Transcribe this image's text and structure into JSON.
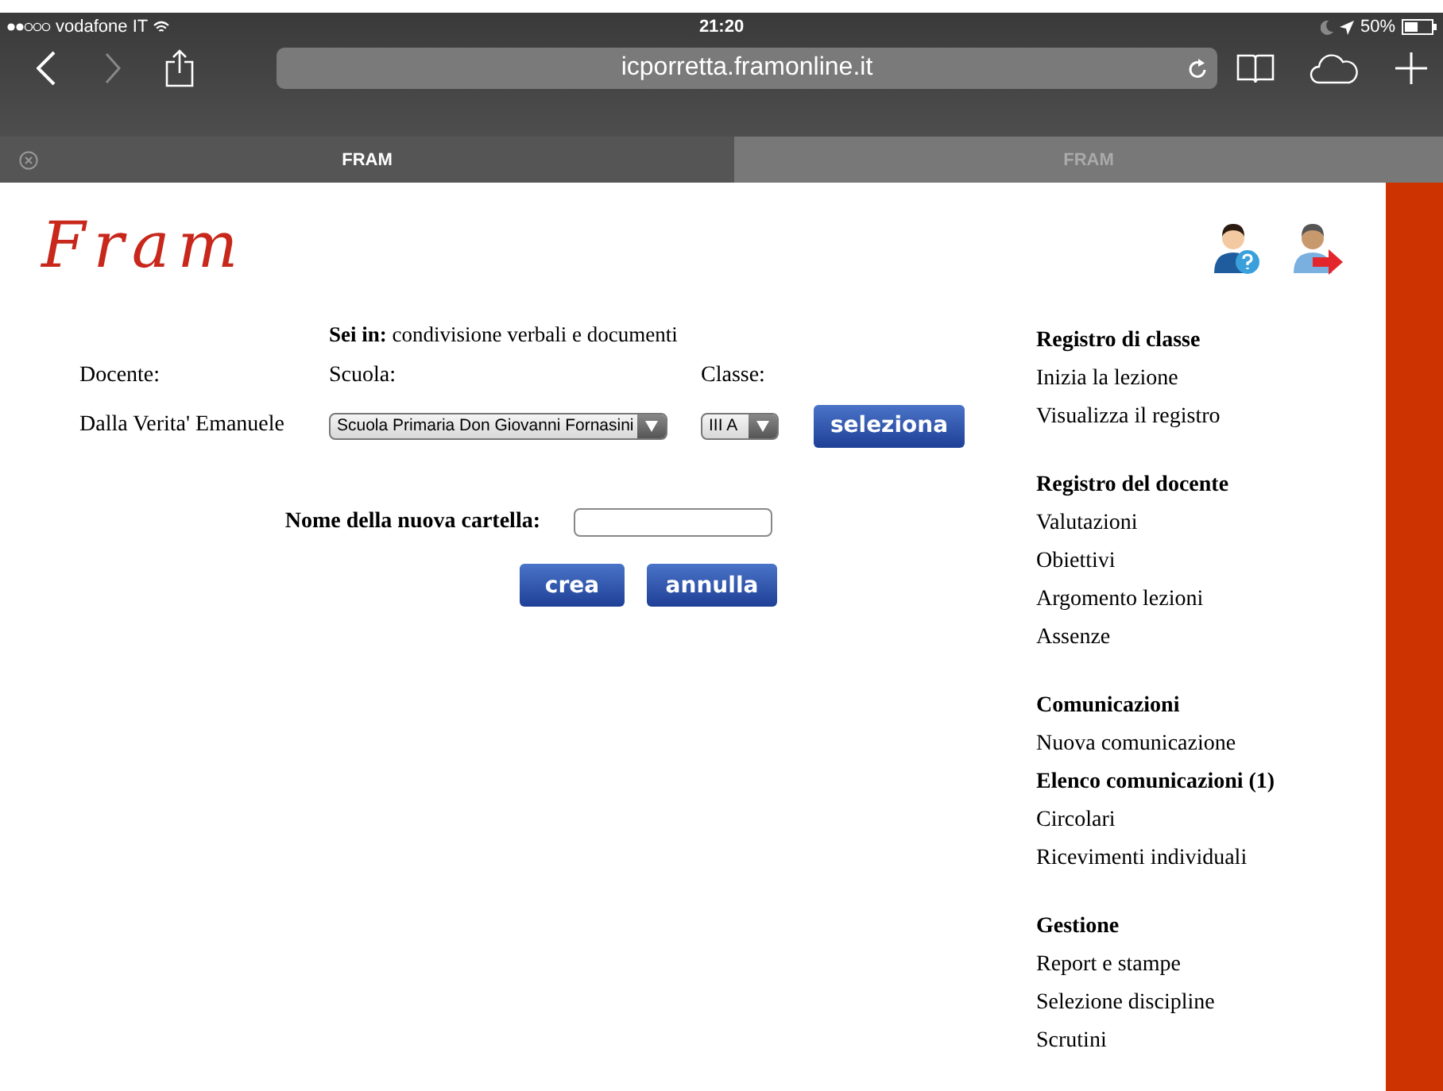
{
  "status_bar": {
    "carrier": "vodafone IT",
    "time": "21:20",
    "battery": "50%"
  },
  "browser": {
    "url": "icporretta.framonline.it"
  },
  "tabs": [
    {
      "label": "FRAM",
      "selected": true
    },
    {
      "label": "FRAM",
      "selected": false
    }
  ],
  "page": {
    "logo": "Fram",
    "breadcrumb": "**Sei in:** condivisione verbali e documenti",
    "labels": {
      "teacher": "Docente:",
      "school": "Scuola:",
      "class": "Classe:"
    },
    "teacher": "Dalla Verita' Emanuele",
    "school_select": "Scuola Primaria Don Giovanni Fornasini",
    "class_select": "III A",
    "select_button": "seleziona",
    "folder_label": "Nome della nuova cartella:",
    "buttons": [
      "crea",
      "annulla"
    ]
  },
  "menu": [
    {
      "title": "Registro di classe",
      "items": [
        {
          "label": "Inizia la lezione",
          "bold": false
        },
        {
          "label": "Visualizza il registro",
          "bold": false
        }
      ]
    },
    {
      "title": "Registro del docente",
      "items": [
        {
          "label": "Valutazioni",
          "bold": false
        },
        {
          "label": "Obiettivi",
          "bold": false
        },
        {
          "label": "Argomento lezioni",
          "bold": false
        },
        {
          "label": "Assenze",
          "bold": false
        }
      ]
    },
    {
      "title": "Comunicazioni",
      "items": [
        {
          "label": "Nuova comunicazione",
          "bold": false
        },
        {
          "label": "Elenco comunicazioni (1)",
          "bold": true
        },
        {
          "label": "Circolari",
          "bold": false
        },
        {
          "label": "Ricevimenti individuali",
          "bold": false
        }
      ]
    },
    {
      "title": "Gestione",
      "items": [
        {
          "label": "Report e stampe",
          "bold": false
        },
        {
          "label": "Selezione discipline",
          "bold": false
        },
        {
          "label": "Scrutini",
          "bold": false
        }
      ]
    }
  ]
}
